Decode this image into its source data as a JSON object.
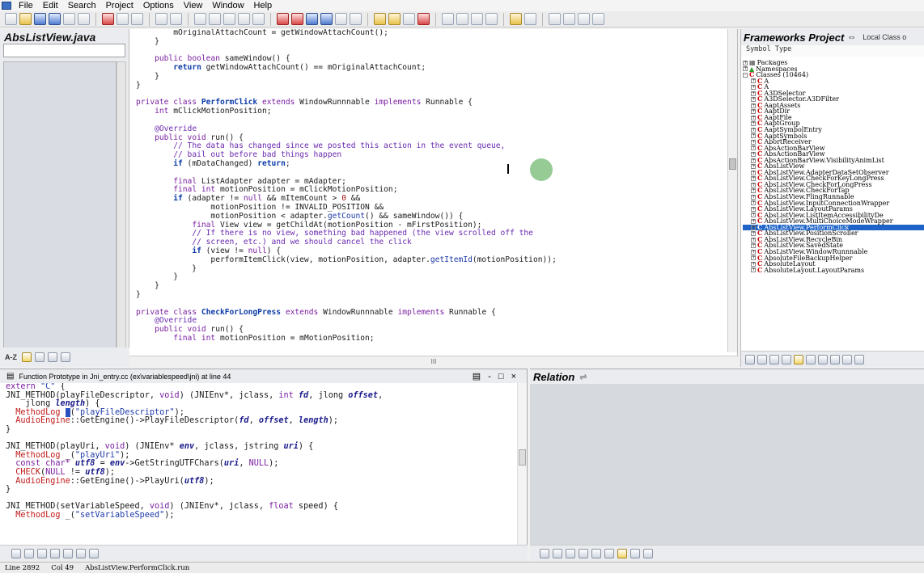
{
  "menubar": {
    "items": [
      "File",
      "Edit",
      "Search",
      "Project",
      "Options",
      "View",
      "Window",
      "Help"
    ]
  },
  "left_panel": {
    "title": "AbsListView.java",
    "sort_label": "A-Z"
  },
  "editor": {
    "hscroll_grip": "III"
  },
  "right_panel": {
    "title": "Frameworks Project",
    "local_tab": "Local Class o",
    "column_header": "Symbol Type",
    "tree": [
      {
        "label": "Packages",
        "kind": "pkg",
        "exp": "+"
      },
      {
        "label": "Namespaces",
        "kind": "ns",
        "exp": "+"
      },
      {
        "label": "Classes (10464)",
        "kind": "cls",
        "exp": "-"
      },
      {
        "label": "A",
        "kind": "c",
        "exp": "+"
      },
      {
        "label": "A",
        "kind": "c",
        "exp": "+"
      },
      {
        "label": "A3DSelector",
        "kind": "c",
        "exp": "+"
      },
      {
        "label": "A3DSelector.A3DFilter",
        "kind": "c",
        "exp": "+"
      },
      {
        "label": "AaptAssets",
        "kind": "c",
        "exp": "+"
      },
      {
        "label": "AaptDir",
        "kind": "c",
        "exp": "+"
      },
      {
        "label": "AaptFile",
        "kind": "c",
        "exp": "+"
      },
      {
        "label": "AaptGroup",
        "kind": "c",
        "exp": "+"
      },
      {
        "label": "AaptSymbolEntry",
        "kind": "c",
        "exp": "+"
      },
      {
        "label": "AaptSymbols",
        "kind": "c",
        "exp": "+"
      },
      {
        "label": "AbortReceiver",
        "kind": "c",
        "exp": "+"
      },
      {
        "label": "AbsActionBarView",
        "kind": "c",
        "exp": "+"
      },
      {
        "label": "AbsActionBarView",
        "kind": "c",
        "exp": "+"
      },
      {
        "label": "AbsActionBarView.VisibilityAnimList",
        "kind": "c",
        "exp": "+"
      },
      {
        "label": "AbsListView",
        "kind": "c",
        "exp": "+"
      },
      {
        "label": "AbsListView.AdapterDataSetObserver",
        "kind": "c",
        "exp": "+"
      },
      {
        "label": "AbsListView.CheckForKeyLongPress",
        "kind": "c",
        "exp": "+"
      },
      {
        "label": "AbsListView.CheckForLongPress",
        "kind": "c",
        "exp": "+"
      },
      {
        "label": "AbsListView.CheckForTap",
        "kind": "c",
        "exp": "+"
      },
      {
        "label": "AbsListView.FlingRunnable",
        "kind": "c",
        "exp": "+"
      },
      {
        "label": "AbsListView.InputConnectionWrapper",
        "kind": "c",
        "exp": "+"
      },
      {
        "label": "AbsListView.LayoutParams",
        "kind": "c",
        "exp": "+"
      },
      {
        "label": "AbsListView.ListItemAccessibilityDe",
        "kind": "c",
        "exp": "+"
      },
      {
        "label": "AbsListView.MultiChoiceModeWrapper",
        "kind": "c",
        "exp": "+"
      },
      {
        "label": "AbsListView.PerformClick",
        "kind": "c",
        "exp": "+",
        "selected": true
      },
      {
        "label": "AbsListView.PositionScroller",
        "kind": "c",
        "exp": "+"
      },
      {
        "label": "AbsListView.RecycleBin",
        "kind": "c",
        "exp": "+"
      },
      {
        "label": "AbsListView.SavedState",
        "kind": "c",
        "exp": "+"
      },
      {
        "label": "AbsListView.WindowRunnnable",
        "kind": "c",
        "exp": "+"
      },
      {
        "label": "AbsoluteFileBackupHelper",
        "kind": "c",
        "exp": "+"
      },
      {
        "label": "AbsoluteLayout",
        "kind": "c",
        "exp": "+"
      },
      {
        "label": "AbsoluteLayout.LayoutParams",
        "kind": "c",
        "exp": "+"
      }
    ]
  },
  "context_window": {
    "title": "Function Prototype in Jni_entry.cc (ex\\variablespeed\\jni) at line 44",
    "controls": "▤ - □ ×"
  },
  "relation_window": {
    "title": "Relation"
  },
  "status_bar": {
    "line": "Line 2892",
    "col": "Col 49",
    "symbol": "AbsListView.PerformClick.run"
  },
  "colors": {
    "selection": "#1e64c8",
    "keyword": "#7a1fa0",
    "type": "#0d3ca8",
    "cursor_highlight": "#40a040"
  }
}
